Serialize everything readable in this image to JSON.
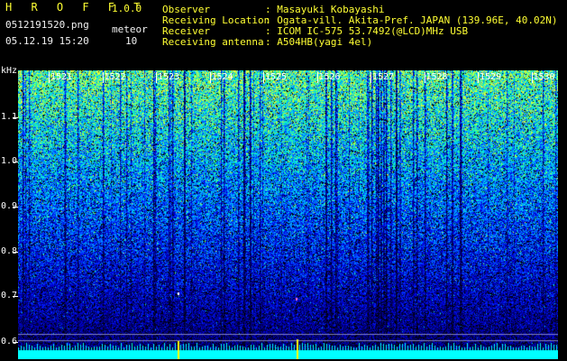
{
  "app": {
    "title": "H R O F F T",
    "version": "1.0.0",
    "filename": "0512191520.png",
    "datetime": "05.12.19 15:20",
    "meteor_label": "meteor",
    "meteor_count": "10"
  },
  "info": [
    {
      "label": "Observer",
      "value": ": Masayuki Kobayashi"
    },
    {
      "label": "Receiving Location",
      "value": ": Ogata-vill. Akita-Pref. JAPAN (139.96E, 40.02N)"
    },
    {
      "label": "Receiver",
      "value": ": ICOM IC-575 53.7492(@LCD)MHz USB"
    },
    {
      "label": "Receiving antenna",
      "value": ": A504HB(yagi 4el)"
    }
  ],
  "yaxis": {
    "unit": "kHz",
    "ticks": [
      "1.1",
      "1.0",
      "0.9",
      "0.8",
      "0.7",
      "0.6"
    ]
  },
  "time_labels": [
    "1521",
    "1522",
    "1523",
    "1524",
    "1525",
    "1526",
    "1527",
    "1528",
    "1529",
    "1530"
  ],
  "colors": {
    "background": "#000000",
    "text_yellow": "#ffff33",
    "text_white": "#f2f2f2",
    "signal_cyan": "#00ffff",
    "meteor_yellow": "#ffff00"
  }
}
